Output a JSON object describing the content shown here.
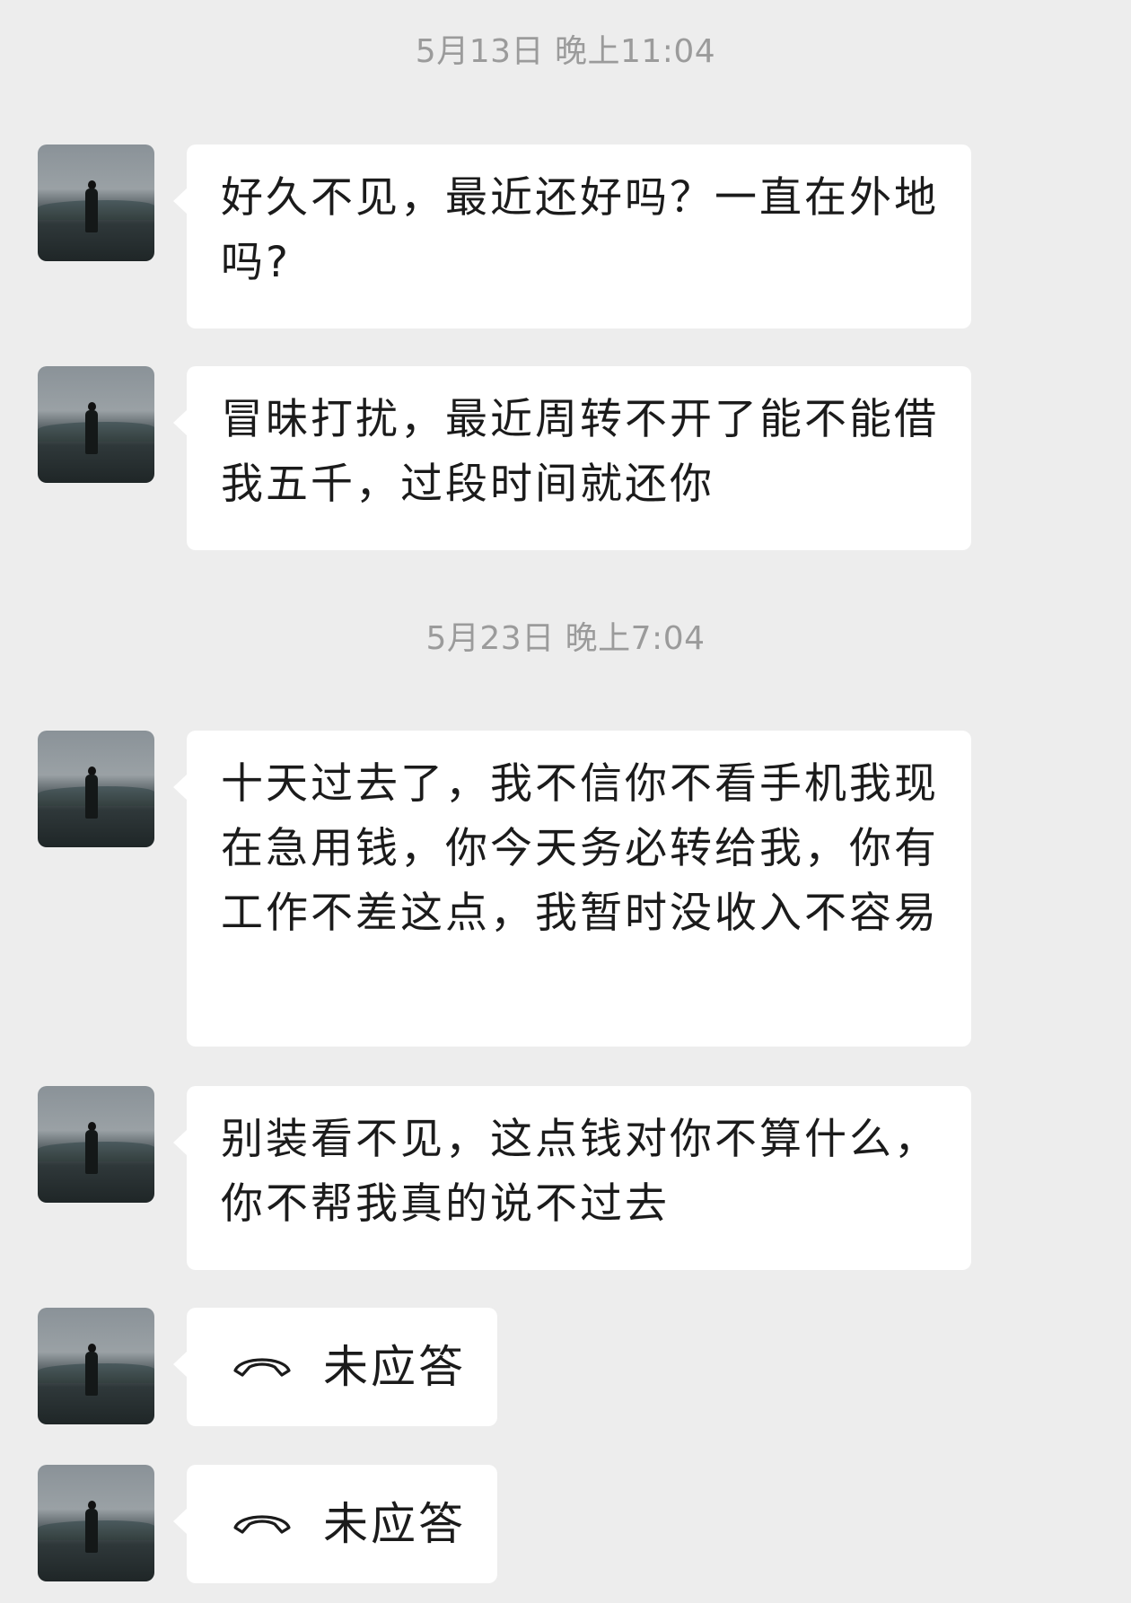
{
  "timestamps": [
    "5月13日 晚上11:04",
    "5月23日 晚上7:04"
  ],
  "messages": [
    {
      "text": "好久不见，最近还好吗？一直在外地吗?"
    },
    {
      "text": "冒昧打扰，最近周转不开了能不能借我五千，过段时间就还你"
    },
    {
      "text": "十天过去了，我不信你不看手机我现在急用钱，你今天务必转给我，你有工作不差这点，我暂时没收入不容易"
    },
    {
      "text": "别装看不见，这点钱对你不算什么，你不帮我真的说不过去"
    }
  ],
  "calls": [
    {
      "icon": "phone-missed-icon",
      "label": "未应答"
    },
    {
      "icon": "phone-missed-icon",
      "label": "未应答"
    }
  ]
}
